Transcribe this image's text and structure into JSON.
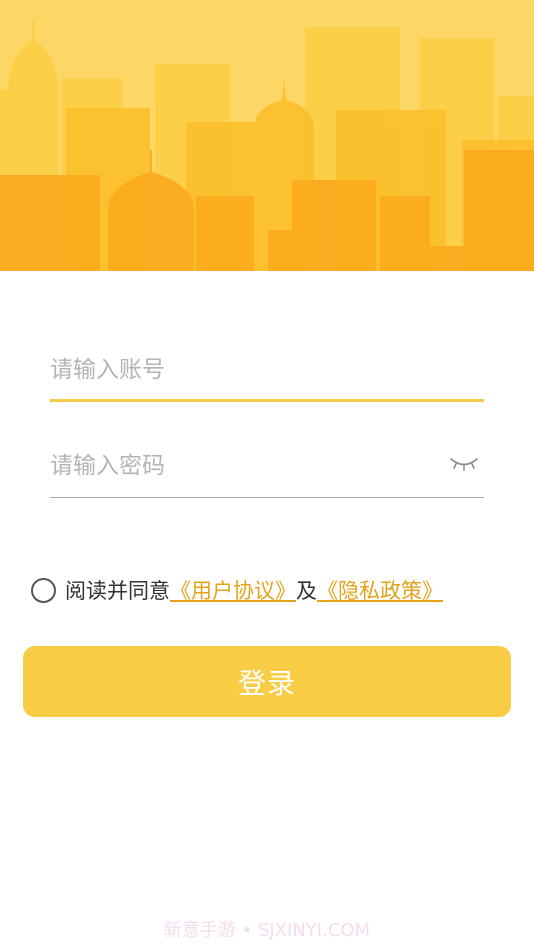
{
  "hero": {
    "icon": "city-skyline-illustration",
    "colors": {
      "sky": "#fcd766",
      "back": "#fbcf45",
      "mid": "#fcbf2b",
      "front": "#fcab1f"
    }
  },
  "account": {
    "placeholder": "请输入账号",
    "value": ""
  },
  "password": {
    "placeholder": "请输入密码",
    "value": "",
    "toggle_icon": "eye-closed-icon"
  },
  "agreement": {
    "checked": false,
    "prefix": "阅读并同意",
    "user_agreement_link": "《用户协议》",
    "and": "及",
    "privacy_policy_link": "《隐私政策》"
  },
  "login": {
    "label": "登录",
    "color": "#f8cc45"
  },
  "watermark": {
    "text": "新意手游 • SJXINYI.COM"
  }
}
